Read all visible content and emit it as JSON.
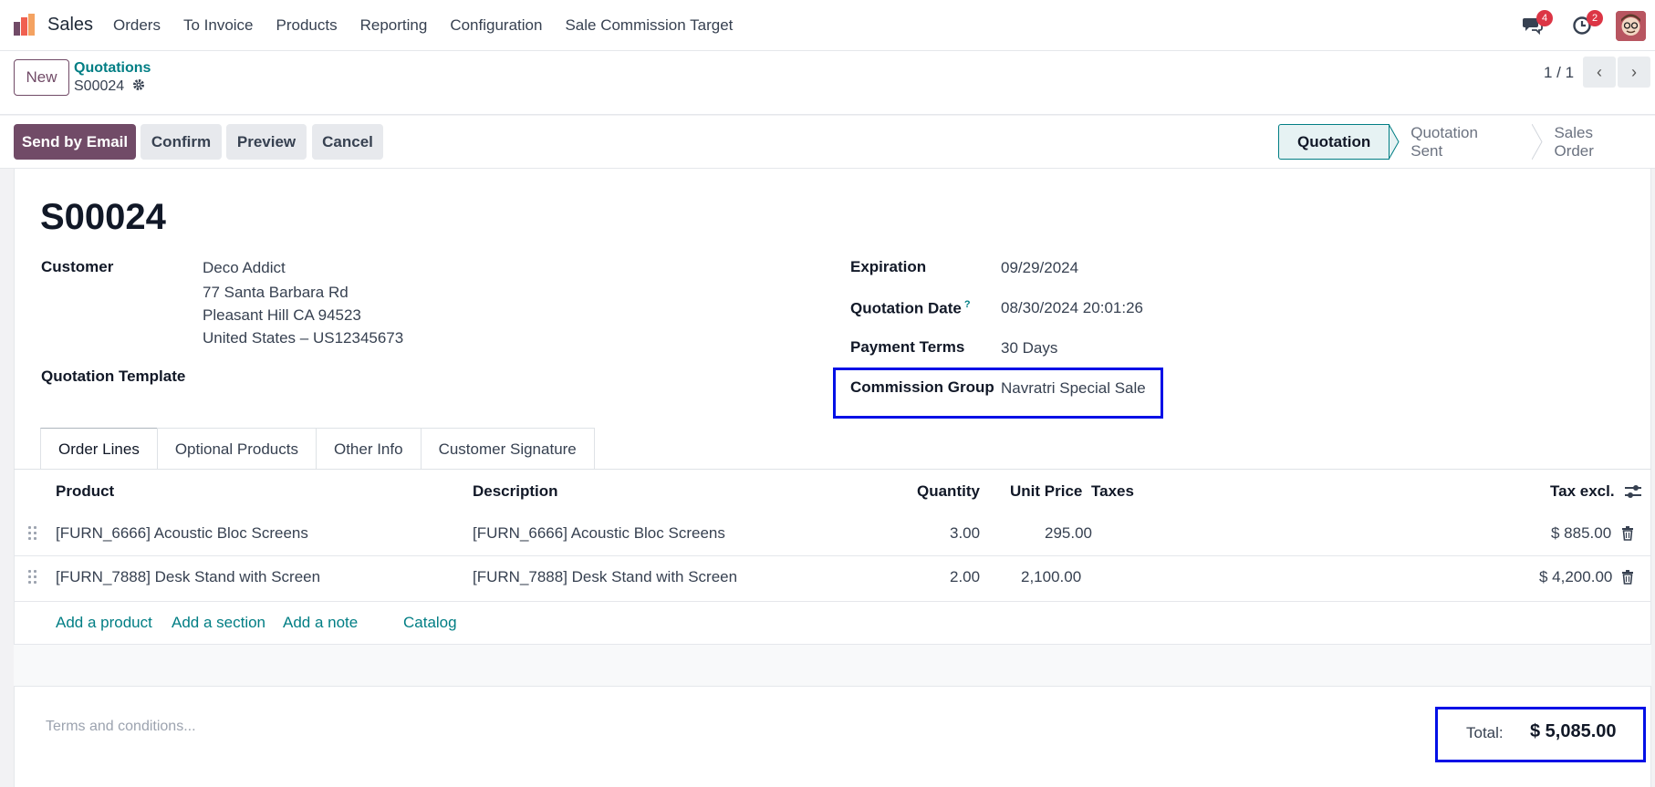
{
  "nav": {
    "app_name": "Sales",
    "menu": [
      "Orders",
      "To Invoice",
      "Products",
      "Reporting",
      "Configuration",
      "Sale Commission Target"
    ],
    "messages_badge": "4",
    "activities_badge": "2"
  },
  "control": {
    "new_label": "New",
    "breadcrumb_parent": "Quotations",
    "breadcrumb_current": "S00024",
    "pager": "1 / 1"
  },
  "actions": {
    "send_email": "Send by Email",
    "confirm": "Confirm",
    "preview": "Preview",
    "cancel": "Cancel"
  },
  "status": {
    "stages": [
      "Quotation",
      "Quotation Sent",
      "Sales Order"
    ],
    "active": "Quotation"
  },
  "form": {
    "title": "S00024",
    "customer_label": "Customer",
    "customer_name": "Deco Addict",
    "customer_addr1": "77 Santa Barbara Rd",
    "customer_addr2": "Pleasant Hill CA 94523",
    "customer_addr3": "United States – US12345673",
    "template_label": "Quotation Template",
    "expiration_label": "Expiration",
    "expiration": "09/29/2024",
    "quote_date_label": "Quotation Date",
    "quote_date_help": "?",
    "quote_date": "08/30/2024 20:01:26",
    "payment_label": "Payment Terms",
    "payment": "30 Days",
    "commission_label": "Commission Group",
    "commission": "Navratri Special Sale"
  },
  "tabs": [
    "Order Lines",
    "Optional Products",
    "Other Info",
    "Customer Signature"
  ],
  "table": {
    "headers": {
      "product": "Product",
      "description": "Description",
      "quantity": "Quantity",
      "unit_price": "Unit Price",
      "taxes": "Taxes",
      "tax_excl": "Tax excl."
    },
    "rows": [
      {
        "product": "[FURN_6666] Acoustic Bloc Screens",
        "description": "[FURN_6666] Acoustic Bloc Screens",
        "quantity": "3.00",
        "unit_price": "295.00",
        "taxes": "",
        "subtotal": "$ 885.00"
      },
      {
        "product": "[FURN_7888] Desk Stand with Screen",
        "description": "[FURN_7888] Desk Stand with Screen",
        "quantity": "2.00",
        "unit_price": "2,100.00",
        "taxes": "",
        "subtotal": "$ 4,200.00"
      }
    ],
    "add_product": "Add a product",
    "add_section": "Add a section",
    "add_note": "Add a note",
    "catalog": "Catalog"
  },
  "footer": {
    "terms_placeholder": "Terms and conditions...",
    "total_label": "Total:",
    "total_value": "$ 5,085.00"
  },
  "colors": {
    "primary": "#714b67",
    "link": "#017e84",
    "highlight": "#0010e6",
    "badge": "#dc3545"
  }
}
